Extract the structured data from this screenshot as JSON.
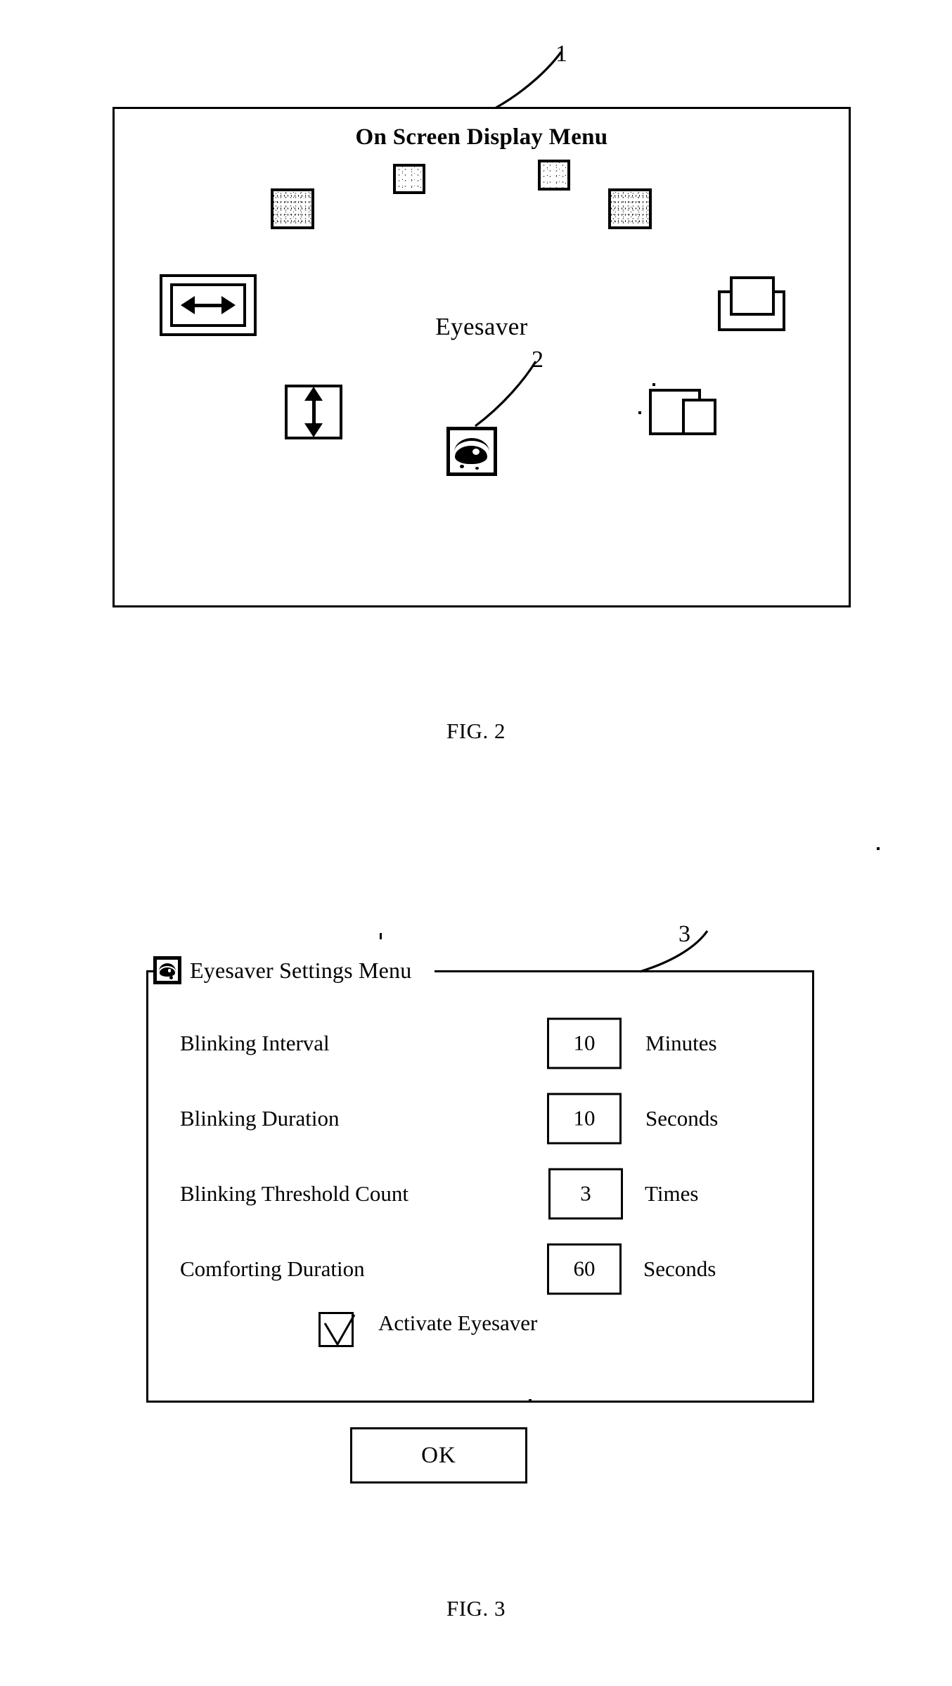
{
  "document": {
    "type": "patent-drawing",
    "figures": [
      {
        "caption": "FIG. 2",
        "callout": "1",
        "osd": {
          "title": "On Screen Display Menu",
          "center_label": "Eyesaver",
          "eyesaver_callout": "2",
          "icons": [
            {
              "name": "brightness-icon",
              "kind": "noise-square-small"
            },
            {
              "name": "contrast-icon",
              "kind": "noise-square-small"
            },
            {
              "name": "color-temp-icon",
              "kind": "noise-square"
            },
            {
              "name": "position-icon",
              "kind": "noise-square"
            },
            {
              "name": "horizontal-size-icon",
              "kind": "h-arrow-box"
            },
            {
              "name": "window-restore-icon",
              "kind": "window-stack-a"
            },
            {
              "name": "vertical-size-icon",
              "kind": "v-arrow-box"
            },
            {
              "name": "window-overlap-icon",
              "kind": "window-stack-b"
            },
            {
              "name": "eyesaver-icon",
              "kind": "eye"
            }
          ]
        }
      },
      {
        "caption": "FIG. 3",
        "callout": "3",
        "dialog": {
          "title": "Eyesaver Settings Menu",
          "title_icon": "eye-icon",
          "settings": [
            {
              "label": "Blinking Interval",
              "value": "10",
              "unit": "Minutes"
            },
            {
              "label": "Blinking Duration",
              "value": "10",
              "unit": "Seconds"
            },
            {
              "label": "Blinking Threshold Count",
              "value": "3",
              "unit": "Times"
            },
            {
              "label": "Comforting Duration",
              "value": "60",
              "unit": "Seconds"
            }
          ],
          "checkbox": {
            "label": "Activate Eyesaver",
            "checked": true
          },
          "ok_label": "OK"
        }
      }
    ]
  },
  "colors": {
    "ink": "#000000",
    "paper": "#ffffff"
  }
}
